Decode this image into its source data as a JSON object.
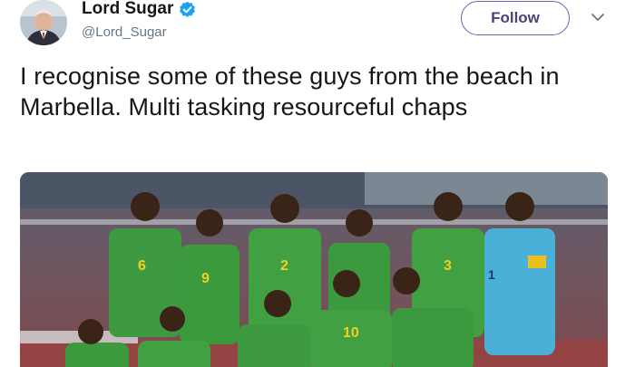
{
  "tweet": {
    "display_name": "Lord Sugar",
    "handle": "@Lord_Sugar",
    "verified": true,
    "follow_label": "Follow",
    "text": "I recognise some of these guys from the beach in Marbella. Multi tasking resourceful chaps"
  },
  "icons": {
    "verified": "verified-badge-icon",
    "menu": "chevron-down-icon"
  },
  "colors": {
    "follow_border": "#7a5fb0",
    "verified_badge": "#1da1f2",
    "handle_text": "#657786"
  },
  "photo": {
    "jersey_numbers": [
      "6",
      "2",
      "3",
      "9",
      "10",
      "1"
    ]
  }
}
